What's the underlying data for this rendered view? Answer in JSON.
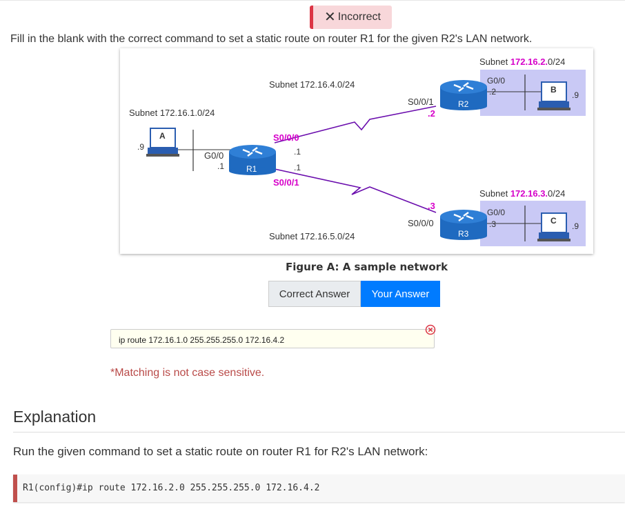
{
  "status": {
    "icon": "close-icon",
    "text": "Incorrect"
  },
  "question": "Fill in the blank with the correct command to set a static route on router R1 for the given R2's LAN network.",
  "figure": {
    "caption": "Figure A: A sample network",
    "subnets": {
      "r1_lan": "Subnet 172.16.1.0/24",
      "r1_r2": "Subnet 172.16.4.0/24",
      "r1_r3": "Subnet 172.16.5.0/24",
      "r2_lan_prefix": "Subnet ",
      "r2_lan_hl": "172.16.2.",
      "r2_lan_suffix": "0/24",
      "r3_lan_prefix": "Subnet ",
      "r3_lan_hl": "172.16.3.",
      "r3_lan_suffix": "0/24"
    },
    "routers": {
      "r1": "R1",
      "r2": "R2",
      "r3": "R3"
    },
    "pcs": {
      "a": "A",
      "b": "B",
      "c": "C"
    },
    "host_labels": {
      "a": ".9",
      "b": ".9",
      "c": ".9"
    },
    "interfaces": {
      "r1_g00": "G0/0",
      "r1_g00_ip": ".1",
      "r1_s000": "S0/0/0",
      "r1_s000_ip": ".1",
      "r1_s001": "S0/0/1",
      "r1_s001_ip": ".1",
      "r2_s001": "S0/0/1",
      "r2_s001_ip": ".2",
      "r2_g00": "G0/0",
      "r2_g00_ip": ".2",
      "r3_s000": "S0/0/0",
      "r3_s000_ip": ".3",
      "r3_g00": "G0/0",
      "r3_g00_ip": ".3"
    }
  },
  "tabs": {
    "correct": "Correct Answer",
    "yours": "Your Answer"
  },
  "answer": {
    "value": "ip route 172.16.1.0 255.255.255.0 172.16.4.2",
    "status_icon": "error-circle-x-icon"
  },
  "note": "*Matching is not case sensitive.",
  "explanation": {
    "title": "Explanation",
    "text": "Run the given command to set a static route on router R1 for R2's LAN network:",
    "code": "R1(config)#ip route 172.16.2.0 255.255.255.0 172.16.4.2"
  },
  "colors": {
    "link_line": "#6a0dad",
    "highlight": "#d600c9",
    "router": "#2f7fd6",
    "lan_box": "#c9c9f5",
    "accent": "#007bff",
    "error": "#dc3545"
  }
}
